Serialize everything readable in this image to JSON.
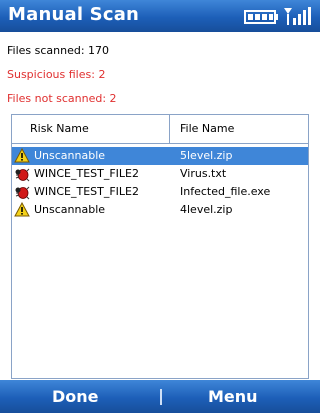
{
  "header": {
    "title": "Manual Scan"
  },
  "stats": {
    "files_scanned": "Files scanned: 170",
    "suspicious_files": "Suspicious files: 2",
    "files_not_scanned": "Files not scanned: 2"
  },
  "table": {
    "columns": [
      "Risk Name",
      "File Name"
    ],
    "rows": [
      {
        "risk": "Unscannable",
        "file": "5level.zip",
        "icon": "warning-icon",
        "selected": true
      },
      {
        "risk": "WINCE_TEST_FILE2",
        "file": "Virus.txt",
        "icon": "bug-icon",
        "selected": false
      },
      {
        "risk": "WINCE_TEST_FILE2",
        "file": "Infected_file.exe",
        "icon": "bug-icon",
        "selected": false
      },
      {
        "risk": "Unscannable",
        "file": "4level.zip",
        "icon": "warning-icon",
        "selected": false
      }
    ]
  },
  "softkeys": {
    "left": "Done",
    "right": "Menu"
  },
  "colors": {
    "titlebar": "#1d5fb8",
    "selection": "#3f86d8",
    "alert_text": "#e03030"
  }
}
